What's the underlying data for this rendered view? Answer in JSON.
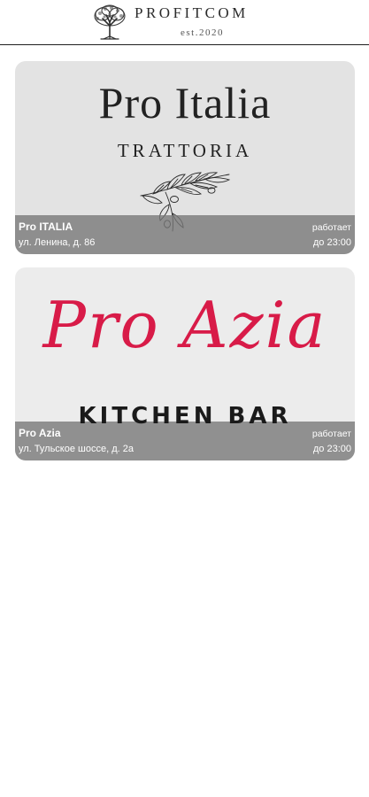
{
  "header": {
    "brand_name": "PROFITCOM",
    "brand_est": "est.2020",
    "logo_icon": "tree-icon"
  },
  "restaurants": [
    {
      "logo_title": "Pro Italia",
      "logo_subtitle": "TRATTORIA",
      "logo_icon": "olive-branch-icon",
      "name": "Pro ITALIA",
      "address": "ул. Ленина, д. 86",
      "status": "работает",
      "hours": "до 23:00"
    },
    {
      "logo_title": "Pro Azia",
      "logo_subtitle": "KITCHEN BAR",
      "name": "Pro Azia",
      "address": "ул. Тульское шоссе, д. 2а",
      "status": "работает",
      "hours": "до 23:00"
    }
  ],
  "colors": {
    "azia_accent": "#d81b48",
    "info_bar": "#767676",
    "header_rule": "#1e1e1e"
  }
}
